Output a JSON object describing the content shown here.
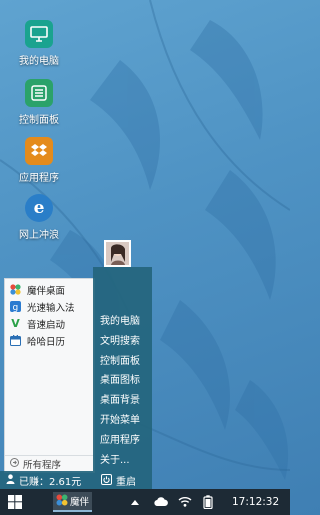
{
  "desktop": {
    "icons": [
      {
        "label": "我的电脑",
        "icon": "computer-icon",
        "color": "#1aa38f"
      },
      {
        "label": "控制面板",
        "icon": "control-panel-icon",
        "color": "#2ba26a"
      },
      {
        "label": "应用程序",
        "icon": "dropbox-icon",
        "color": "#e48b1c"
      },
      {
        "label": "网上冲浪",
        "icon": "ie-browser-icon",
        "color": "#2a7ec8"
      }
    ]
  },
  "start_menu": {
    "programs": [
      {
        "label": "魔伴桌面",
        "icon": "pinwheel-icon"
      },
      {
        "label": "光速输入法",
        "icon": "input-method-icon"
      },
      {
        "label": "音速启动",
        "icon": "v-launcher-icon"
      },
      {
        "label": "哈哈日历",
        "icon": "calendar-icon"
      }
    ],
    "all_programs": "所有程序",
    "links": [
      "我的电脑",
      "文明搜索",
      "控制面板",
      "桌面图标",
      "桌面背景",
      "开始菜单",
      "应用程序",
      "关于..."
    ],
    "earned": "已赚：2.61元",
    "restart": "重启"
  },
  "taskbar": {
    "app_label": "魔伴",
    "clock": "17:12:32",
    "accent": "#1d2a35"
  }
}
